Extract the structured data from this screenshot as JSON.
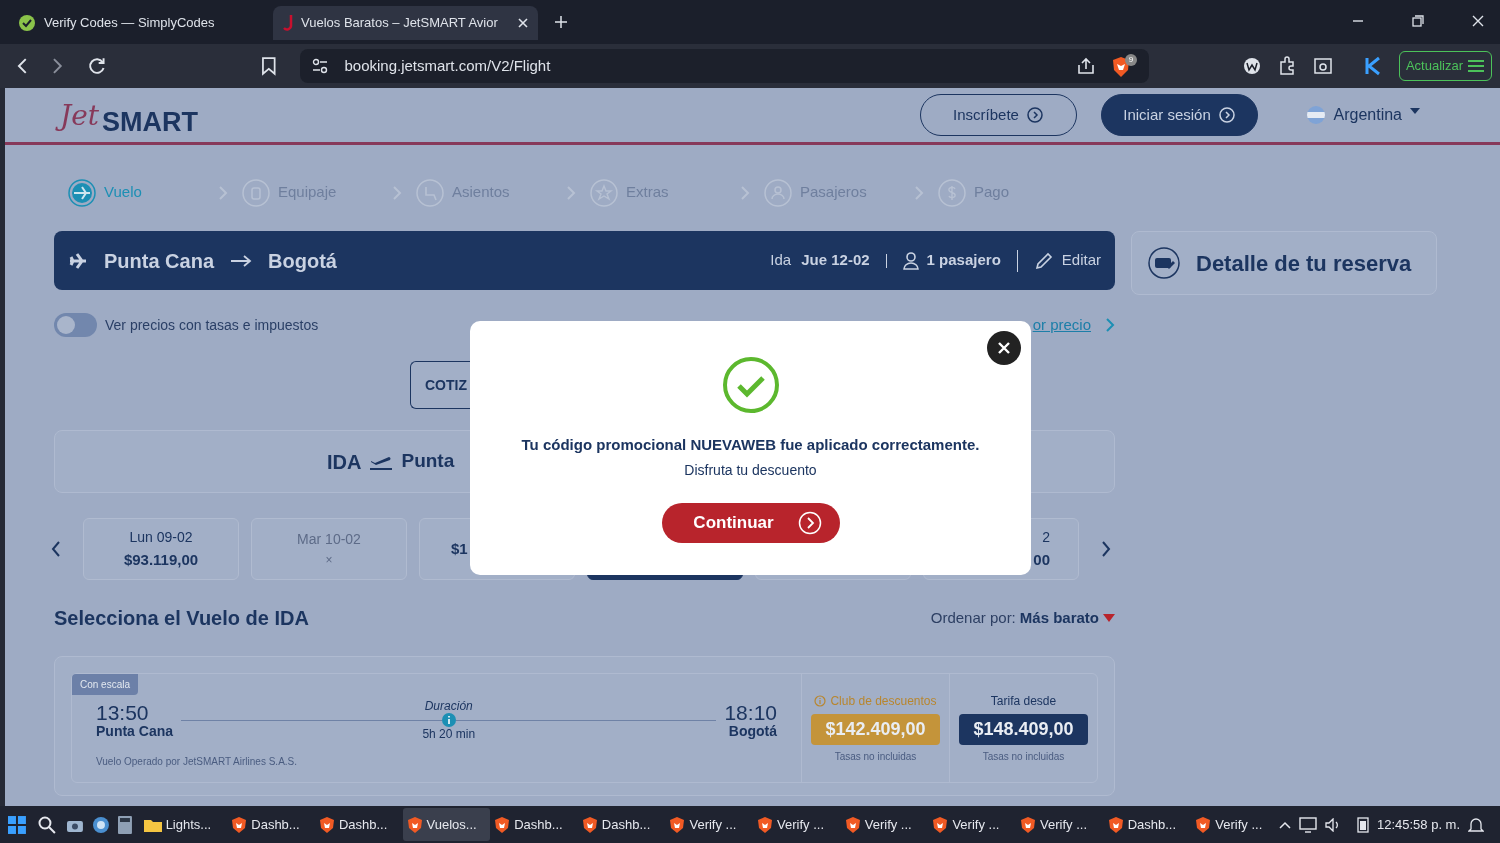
{
  "browser": {
    "tabs": [
      {
        "title": "Verify Codes — SimplyCodes",
        "selected": false
      },
      {
        "title": "Vuelos Baratos – JetSMART Avior",
        "selected": true
      }
    ],
    "url": "booking.jetsmart.com/V2/Flight",
    "extension_badge": "9",
    "update_button": "Actualizar"
  },
  "header": {
    "logo_script": "Jet",
    "logo_main": "SMART",
    "signup": "Inscríbete",
    "login": "Iniciar sesión",
    "country": "Argentina"
  },
  "steps": [
    {
      "label": "Vuelo",
      "selected": true
    },
    {
      "label": "Equipaje",
      "selected": false
    },
    {
      "label": "Asientos",
      "selected": false
    },
    {
      "label": "Extras",
      "selected": false
    },
    {
      "label": "Pasajeros",
      "selected": false
    },
    {
      "label": "Pago",
      "selected": false
    }
  ],
  "route_bar": {
    "origin": "Punta Cana",
    "destination": "Bogotá",
    "trip_label": "Ida",
    "date": "Jue 12-02",
    "passengers": "1 pasajero",
    "edit": "Editar"
  },
  "booking_detail": {
    "title": "Detalle de tu reserva"
  },
  "tax_toggle": {
    "label": "Ver precios con tasas e impuestos",
    "on": false
  },
  "price_link": "or precio",
  "quote_button": "COTIZ",
  "ida_header": {
    "label": "IDA",
    "city": "Punta"
  },
  "dates": [
    {
      "kind": "full",
      "day": "Lun 09-02",
      "price": "$93.119,00",
      "selected": false,
      "available": true
    },
    {
      "kind": "full",
      "day": "Mar 10-02",
      "price": "×",
      "selected": false,
      "available": false
    },
    {
      "kind": "cut-right",
      "price": "$1",
      "selected": false,
      "available": true
    },
    {
      "kind": "hidden",
      "selected": true
    },
    {
      "kind": "hidden",
      "selected": false
    },
    {
      "kind": "cut-left",
      "day": "2",
      "price": "00",
      "selected": false,
      "available": true
    }
  ],
  "section_title": "Selecciona el Vuelo de IDA",
  "sort": {
    "label": "Ordenar por:",
    "value": "Más barato"
  },
  "flights": [
    {
      "tag": "Con escala",
      "depart_time": "13:50",
      "depart_city": "Punta Cana",
      "duration_label": "Duración",
      "duration": "5h 20 min",
      "arrive_time": "18:10",
      "arrive_city": "Bogotá",
      "operator": "Vuelo Operado por JetSMART Airlines S.A.S.",
      "club_label": "Club de descuentos",
      "club_price": "$142.409,00",
      "club_note": "Tasas no incluidas",
      "fare_label": "Tarifa desde",
      "fare_price": "$148.409,00",
      "fare_note": "Tasas no incluidas"
    }
  ],
  "modal": {
    "message": "Tu código promocional NUEVAWEB fue aplicado correctamente.",
    "subtitle": "Disfruta tu descuento",
    "button": "Continuar"
  },
  "taskbar": {
    "items": [
      {
        "label": "Lights...",
        "kind": "folder",
        "selected": false
      },
      {
        "label": "Dashb...",
        "kind": "browser",
        "selected": false
      },
      {
        "label": "Dashb...",
        "kind": "browser",
        "selected": false
      },
      {
        "label": "Vuelos...",
        "kind": "browser",
        "selected": true
      },
      {
        "label": "Dashb...",
        "kind": "browser",
        "selected": false
      },
      {
        "label": "Dashb...",
        "kind": "browser",
        "selected": false
      },
      {
        "label": "Verify ...",
        "kind": "browser",
        "selected": false
      },
      {
        "label": "Verify ...",
        "kind": "browser",
        "selected": false
      },
      {
        "label": "Verify ...",
        "kind": "browser",
        "selected": false
      },
      {
        "label": "Verify ...",
        "kind": "browser",
        "selected": false
      },
      {
        "label": "Verify ...",
        "kind": "browser",
        "selected": false
      },
      {
        "label": "Dashb...",
        "kind": "browser",
        "selected": false
      },
      {
        "label": "Verify ...",
        "kind": "browser",
        "selected": false
      }
    ],
    "clock": "12:45:58 p. m."
  }
}
